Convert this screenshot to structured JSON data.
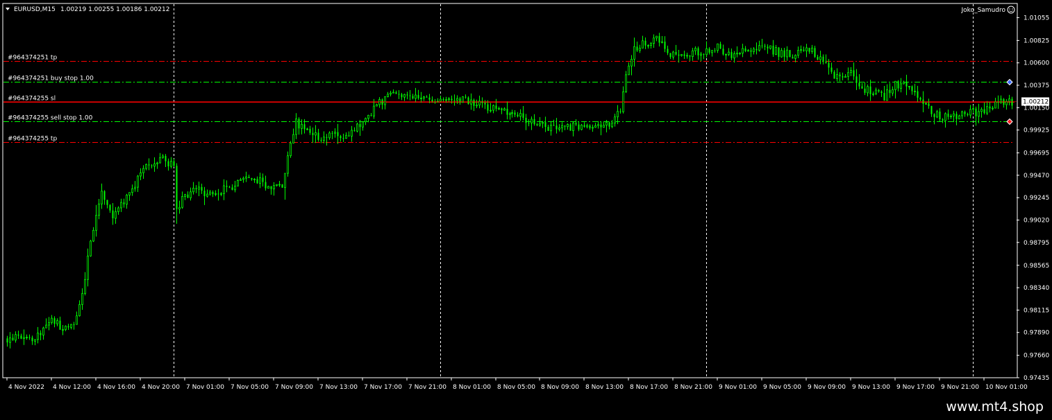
{
  "header": {
    "symbol": "EURUSD,M15",
    "ohlc": "1.00219 1.00255 1.00186 1.00212",
    "author": "Joko_Samudro"
  },
  "footer": {
    "url": "www.mt4.shop"
  },
  "colors": {
    "background": "#000000",
    "candle": "#00ff00",
    "frame": "#ffffff",
    "grid_dashed": "#ffffff",
    "tp_line": "#ff0000",
    "stop_line": "#00ff00",
    "sl_line": "#ff0000",
    "bid_line": "#ff0000"
  },
  "chart_data": {
    "type": "candlestick",
    "title": "EURUSD,M15 1.00219 1.00255 1.00186 1.00212",
    "ylim": [
      0.97435,
      1.0119
    ],
    "y_ticks": [
      "1.01055",
      "1.00825",
      "1.00600",
      "1.00375",
      "1.00150",
      "0.99925",
      "0.99695",
      "0.99470",
      "0.99245",
      "0.99020",
      "0.98795",
      "0.98565",
      "0.98340",
      "0.98115",
      "0.97890",
      "0.97660",
      "0.97435"
    ],
    "x_labels": [
      "4 Nov 2022",
      "4 Nov 12:00",
      "4 Nov 16:00",
      "4 Nov 20:00",
      "7 Nov 01:00",
      "7 Nov 05:00",
      "7 Nov 09:00",
      "7 Nov 13:00",
      "7 Nov 17:00",
      "7 Nov 21:00",
      "8 Nov 01:00",
      "8 Nov 05:00",
      "8 Nov 09:00",
      "8 Nov 13:00",
      "8 Nov 17:00",
      "8 Nov 21:00",
      "9 Nov 01:00",
      "9 Nov 05:00",
      "9 Nov 09:00",
      "9 Nov 13:00",
      "9 Nov 17:00",
      "9 Nov 21:00",
      "10 Nov 01:00"
    ],
    "x_label_positions": [
      0,
      16,
      32,
      48,
      64,
      80,
      96,
      112,
      128,
      144,
      160,
      176,
      192,
      208,
      224,
      240,
      256,
      272,
      288,
      304,
      320,
      336,
      352
    ],
    "period_separators": [
      60,
      156,
      252,
      348
    ],
    "candle_count": 363,
    "current_price": "1.00212",
    "price_path": [
      [
        0,
        0.9783
      ],
      [
        8,
        0.9782
      ],
      [
        12,
        0.9788
      ],
      [
        16,
        0.98
      ],
      [
        20,
        0.9795
      ],
      [
        22,
        0.979
      ],
      [
        24,
        0.98
      ],
      [
        27,
        0.983
      ],
      [
        31,
        0.9895
      ],
      [
        34,
        0.9932
      ],
      [
        38,
        0.9908
      ],
      [
        42,
        0.9918
      ],
      [
        46,
        0.9938
      ],
      [
        50,
        0.9956
      ],
      [
        56,
        0.9962
      ],
      [
        60,
        0.9958
      ],
      [
        61,
        0.9913
      ],
      [
        63,
        0.9922
      ],
      [
        67,
        0.9933
      ],
      [
        72,
        0.9929
      ],
      [
        78,
        0.9933
      ],
      [
        84,
        0.9939
      ],
      [
        88,
        0.9944
      ],
      [
        92,
        0.994
      ],
      [
        96,
        0.9933
      ],
      [
        99,
        0.9937
      ],
      [
        102,
        0.9977
      ],
      [
        104,
        1.0
      ],
      [
        108,
        0.999
      ],
      [
        112,
        0.9985
      ],
      [
        116,
        0.999
      ],
      [
        120,
        0.9988
      ],
      [
        124,
        0.999
      ],
      [
        128,
        1.0
      ],
      [
        134,
        1.002
      ],
      [
        140,
        1.003
      ],
      [
        144,
        1.0028
      ],
      [
        150,
        1.0022
      ],
      [
        160,
        1.002
      ],
      [
        164,
        1.0025
      ],
      [
        168,
        1.0018
      ],
      [
        176,
        1.0015
      ],
      [
        182,
        1.0008
      ],
      [
        190,
        1.0
      ],
      [
        194,
        0.9995
      ],
      [
        200,
        0.9995
      ],
      [
        206,
        0.9996
      ],
      [
        212,
        0.9995
      ],
      [
        218,
        1.0
      ],
      [
        221,
        1.0012
      ],
      [
        223,
        1.005
      ],
      [
        226,
        1.0075
      ],
      [
        230,
        1.008
      ],
      [
        234,
        1.0088
      ],
      [
        238,
        1.007
      ],
      [
        242,
        1.0068
      ],
      [
        248,
        1.0072
      ],
      [
        252,
        1.0072
      ],
      [
        256,
        1.0075
      ],
      [
        262,
        1.0065
      ],
      [
        268,
        1.0075
      ],
      [
        274,
        1.0075
      ],
      [
        278,
        1.007
      ],
      [
        284,
        1.0068
      ],
      [
        290,
        1.0073
      ],
      [
        294,
        1.006
      ],
      [
        298,
        1.0045
      ],
      [
        304,
        1.005
      ],
      [
        308,
        1.0035
      ],
      [
        312,
        1.003
      ],
      [
        316,
        1.0025
      ],
      [
        320,
        1.004
      ],
      [
        324,
        1.0035
      ],
      [
        328,
        1.0025
      ],
      [
        334,
        1.001
      ],
      [
        338,
        1.0005
      ],
      [
        344,
        1.0008
      ],
      [
        348,
        1.001
      ],
      [
        352,
        1.0012
      ],
      [
        356,
        1.002
      ],
      [
        362,
        1.0021
      ]
    ],
    "horizontal_lines": [
      {
        "label": "#964374251 tp",
        "price": 1.0062,
        "kind": "tp"
      },
      {
        "label": "#964374251 buy stop 1.00",
        "price": 1.0041,
        "kind": "buy_stop"
      },
      {
        "label": "#964374255 sl",
        "price": 1.0021,
        "kind": "sl"
      },
      {
        "label": "#964374255 sell stop 1.00",
        "price": 1.0001,
        "kind": "sell_stop"
      },
      {
        "label": "#964374255 tp",
        "price": 0.99805,
        "kind": "tp"
      }
    ]
  }
}
